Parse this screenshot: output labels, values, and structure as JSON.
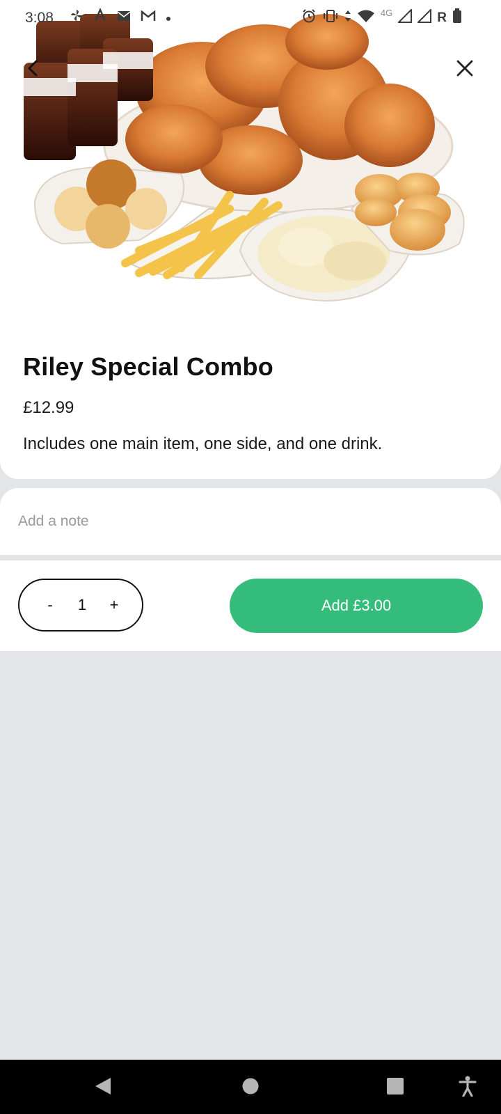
{
  "status_bar": {
    "time": "3:08",
    "left_icons": [
      "fan-icon",
      "a-icon",
      "mail-icon",
      "gmail-icon",
      "dot-icon"
    ],
    "right_icons": [
      "alarm-icon",
      "vibrate-icon",
      "wifi-icon",
      "signal-icon",
      "signal-icon",
      "battery-icon"
    ],
    "network_label": "4G",
    "roaming_label": "R"
  },
  "product": {
    "title": "Riley Special Combo",
    "price": "£12.99",
    "description": "Includes one main item, one side, and one drink.",
    "image_alt": "Fried chicken combo with fries, coleslaw, mashed potatoes, biscuits and cola drinks"
  },
  "note": {
    "placeholder": "Add a note",
    "value": ""
  },
  "quantity": {
    "minus_label": "-",
    "value": "1",
    "plus_label": "+"
  },
  "cart": {
    "add_label": "Add £3.00"
  },
  "colors": {
    "accent": "#34bd7a",
    "background": "#e4e5e9",
    "card": "#ffffff"
  }
}
